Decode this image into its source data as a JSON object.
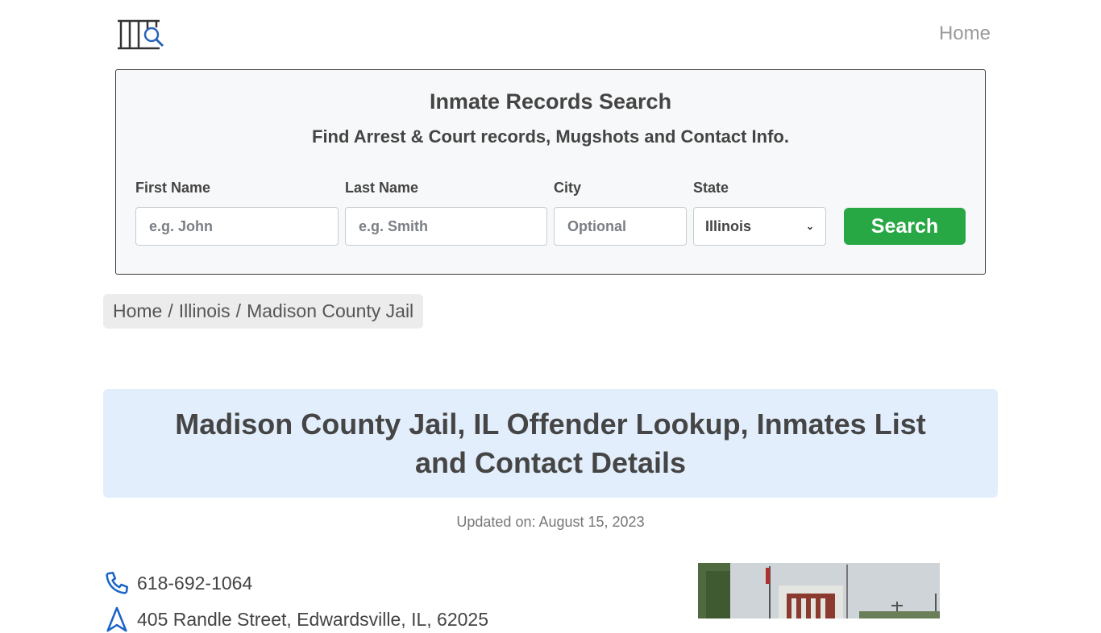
{
  "header": {
    "logo_icon": "jail-bars-search-icon",
    "nav_home": "Home"
  },
  "search": {
    "title": "Inmate Records Search",
    "subtitle": "Find Arrest & Court records, Mugshots and Contact Info.",
    "first_name_label": "First Name",
    "first_name_placeholder": "e.g. John",
    "last_name_label": "Last Name",
    "last_name_placeholder": "e.g. Smith",
    "city_label": "City",
    "city_placeholder": "Optional",
    "state_label": "State",
    "state_value": "Illinois",
    "button_label": "Search",
    "button_color": "#28a745"
  },
  "breadcrumb": {
    "items": [
      "Home",
      "Illinois",
      "Madison County Jail"
    ],
    "separator": "/"
  },
  "page": {
    "title": "Madison County Jail, IL Offender Lookup, Inmates List and Contact Details",
    "updated": "Updated on: August 15, 2023"
  },
  "contact": {
    "phone": "618-692-1064",
    "phone_icon": "phone-icon",
    "address": "405 Randle Street, Edwardsville, IL, 62025",
    "address_icon": "map-pin-icon",
    "icon_color": "#1a64c8"
  },
  "photo": {
    "alt": "Madison County Jail building"
  }
}
